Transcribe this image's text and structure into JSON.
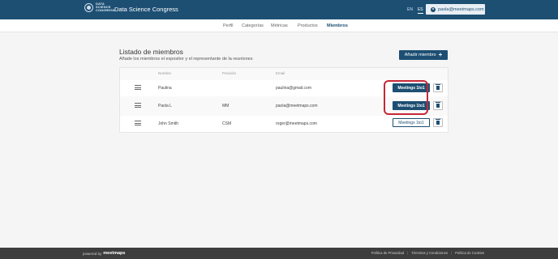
{
  "header": {
    "logo_lines": [
      "DATA",
      "SCIENCE",
      "CONGRESS"
    ],
    "app_title": "Data Science Congress",
    "languages": [
      "EN",
      "ES"
    ],
    "active_language": "ES",
    "user_email": "paola@meetmaps.com"
  },
  "nav": {
    "items": [
      "Perfil",
      "Categorías",
      "Métricas",
      "Productos",
      "Miembros"
    ],
    "active": "Miembros"
  },
  "main": {
    "title": "Listado de miembros",
    "subtitle": "Añade los miembros el expositor y el representante de la reuniones",
    "add_button_label": "Añadir miembro",
    "columns": [
      "Nombre",
      "Posición",
      "Email"
    ],
    "rows": [
      {
        "name": "Paulina",
        "position": "",
        "email": "paulina@gmail.com",
        "meeting_label": "Meetings 1to1",
        "meeting_active": true
      },
      {
        "name": "Paola L",
        "position": "MM",
        "email": "paola@meetmaps.com",
        "meeting_label": "Meetings 1to1",
        "meeting_active": true
      },
      {
        "name": "John Smith",
        "position": "CSM",
        "email": "roger@meetmaps.com",
        "meeting_label": "Meetings 1to1",
        "meeting_active": false
      }
    ]
  },
  "footer": {
    "powered_by": "powered by",
    "brand": "meetmaps",
    "links": [
      "Política de Privacidad",
      "Términos y Condiciones",
      "Política de Cookies"
    ]
  },
  "colors": {
    "brand_blue": "#1d4f73",
    "highlight_red": "#c62838",
    "footer_bg": "#3d3d3d"
  }
}
